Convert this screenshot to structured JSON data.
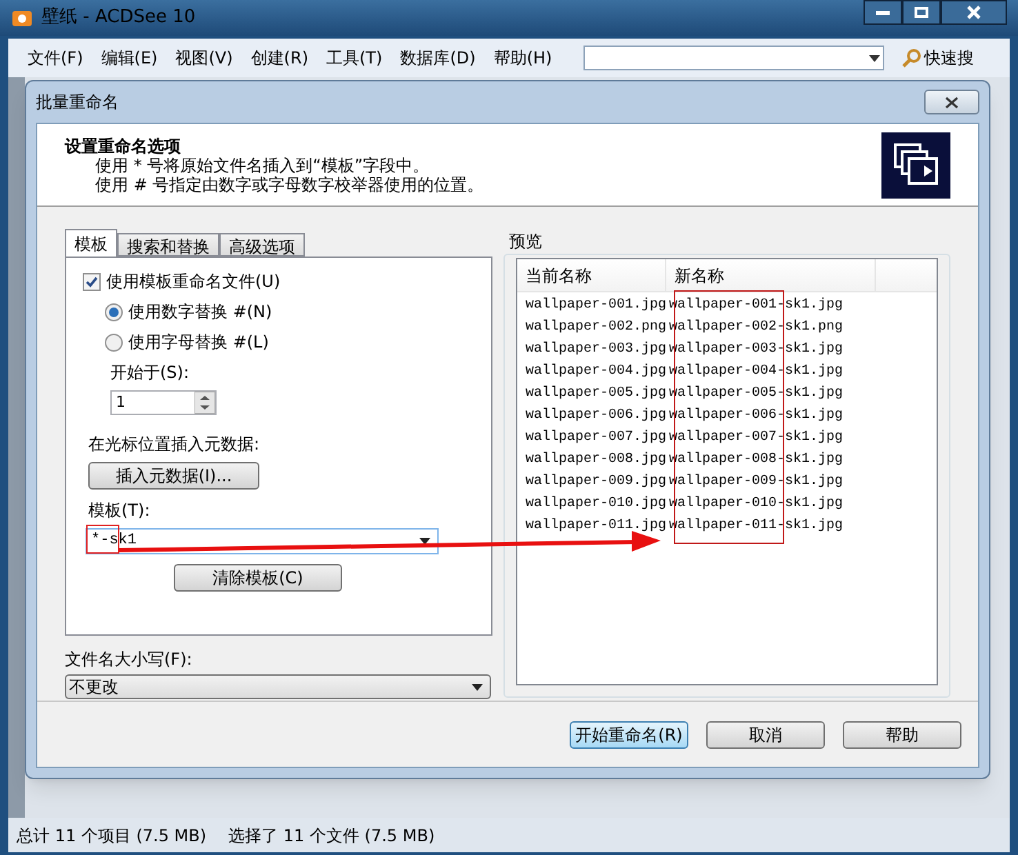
{
  "window": {
    "title": "壁纸 - ACDSee 10"
  },
  "menu": [
    "文件(F)",
    "编辑(E)",
    "视图(V)",
    "创建(R)",
    "工具(T)",
    "数据库(D)",
    "帮助(H)"
  ],
  "quick_search": {
    "label": "快速搜"
  },
  "dialog": {
    "title": "批量重命名",
    "header": {
      "title": "设置重命名选项",
      "lines": [
        "使用 * 号将原始文件名插入到“模板”字段中。",
        "使用 # 号指定由数字或字母数字校举器使用的位置。"
      ]
    },
    "tabs": [
      {
        "label": "模板",
        "selected": true
      },
      {
        "label": "搜索和替换",
        "selected": false
      },
      {
        "label": "高级选项",
        "selected": false
      }
    ],
    "use_template": {
      "label": "使用模板重命名文件(U)",
      "checked": true
    },
    "radios": [
      {
        "label": "使用数字替换 #(N)",
        "selected": true
      },
      {
        "label": "使用字母替换 #(L)",
        "selected": false
      }
    ],
    "start": {
      "label": "开始于(S):",
      "value": "1"
    },
    "insert_label": "在光标位置插入元数据:",
    "insert_button": "插入元数据(I)...",
    "template": {
      "label": "模板(T):",
      "value": "*-sk1"
    },
    "clear_button": "清除模板(C)",
    "case": {
      "label": "文件名大小写(F):",
      "value": "不更改"
    },
    "preview": {
      "label": "预览",
      "columns": [
        "当前名称",
        "新名称"
      ],
      "rows": [
        [
          "wallpaper-001.jpg",
          "wallpaper-001-sk1.jpg"
        ],
        [
          "wallpaper-002.png",
          "wallpaper-002-sk1.png"
        ],
        [
          "wallpaper-003.jpg",
          "wallpaper-003-sk1.jpg"
        ],
        [
          "wallpaper-004.jpg",
          "wallpaper-004-sk1.jpg"
        ],
        [
          "wallpaper-005.jpg",
          "wallpaper-005-sk1.jpg"
        ],
        [
          "wallpaper-006.jpg",
          "wallpaper-006-sk1.jpg"
        ],
        [
          "wallpaper-007.jpg",
          "wallpaper-007-sk1.jpg"
        ],
        [
          "wallpaper-008.jpg",
          "wallpaper-008-sk1.jpg"
        ],
        [
          "wallpaper-009.jpg",
          "wallpaper-009-sk1.jpg"
        ],
        [
          "wallpaper-010.jpg",
          "wallpaper-010-sk1.jpg"
        ],
        [
          "wallpaper-011.jpg",
          "wallpaper-011-sk1.jpg"
        ]
      ]
    },
    "buttons": [
      {
        "label": "开始重命名(R)",
        "default": true
      },
      {
        "label": "取消",
        "default": false
      },
      {
        "label": "帮助",
        "default": false
      }
    ]
  },
  "status_bar": [
    "总计 11 个项目 (7.5 MB)",
    "选择了 11 个文件 (7.5 MB)"
  ]
}
